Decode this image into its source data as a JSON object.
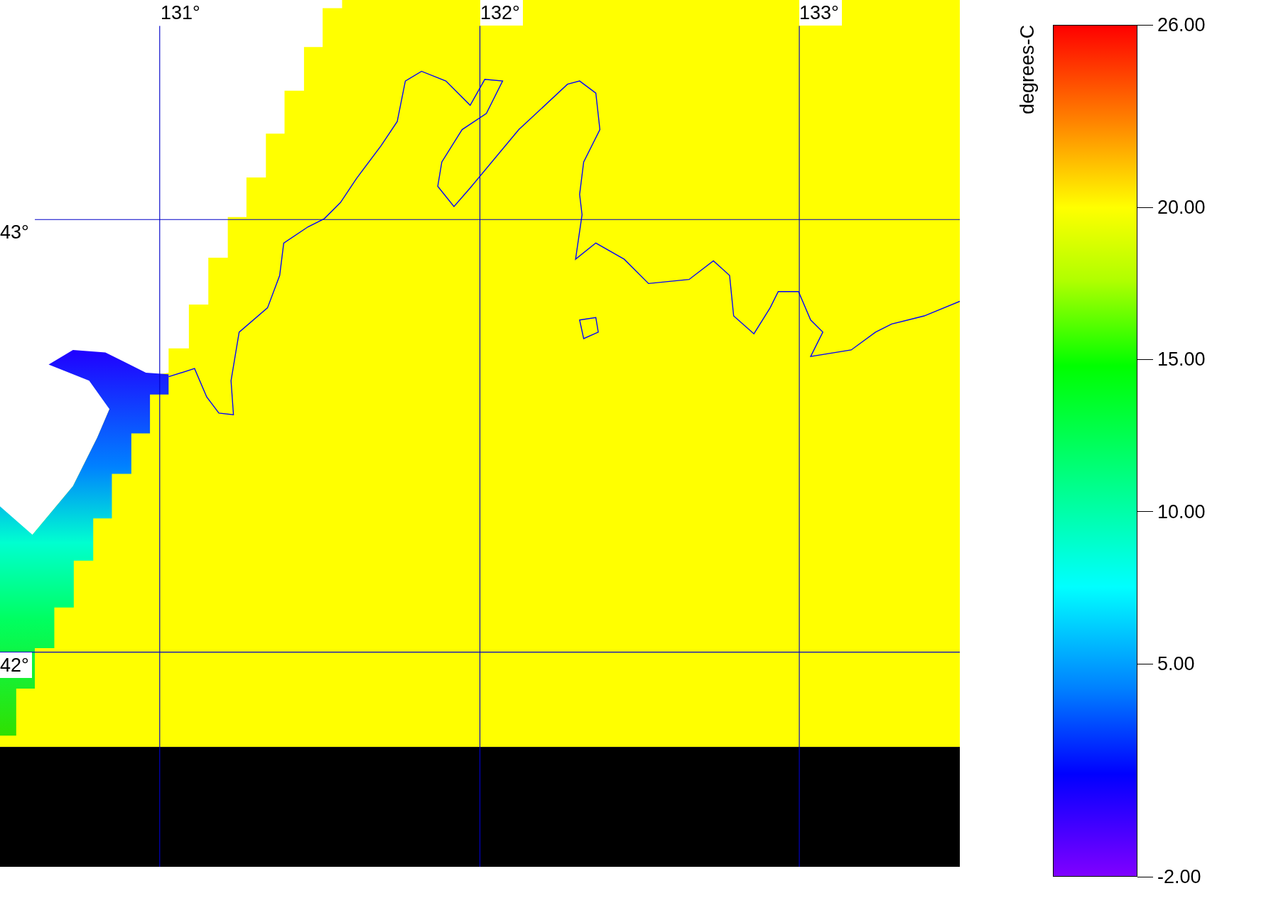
{
  "map": {
    "lon_labels": [
      "131°",
      "132°",
      "133°"
    ],
    "lat_labels": [
      "43°",
      "42°"
    ]
  },
  "colorbar": {
    "title": "degrees-C",
    "ticks": [
      "26.00",
      "20.00",
      "15.00",
      "10.00",
      "5.00",
      "-2.00"
    ]
  }
}
